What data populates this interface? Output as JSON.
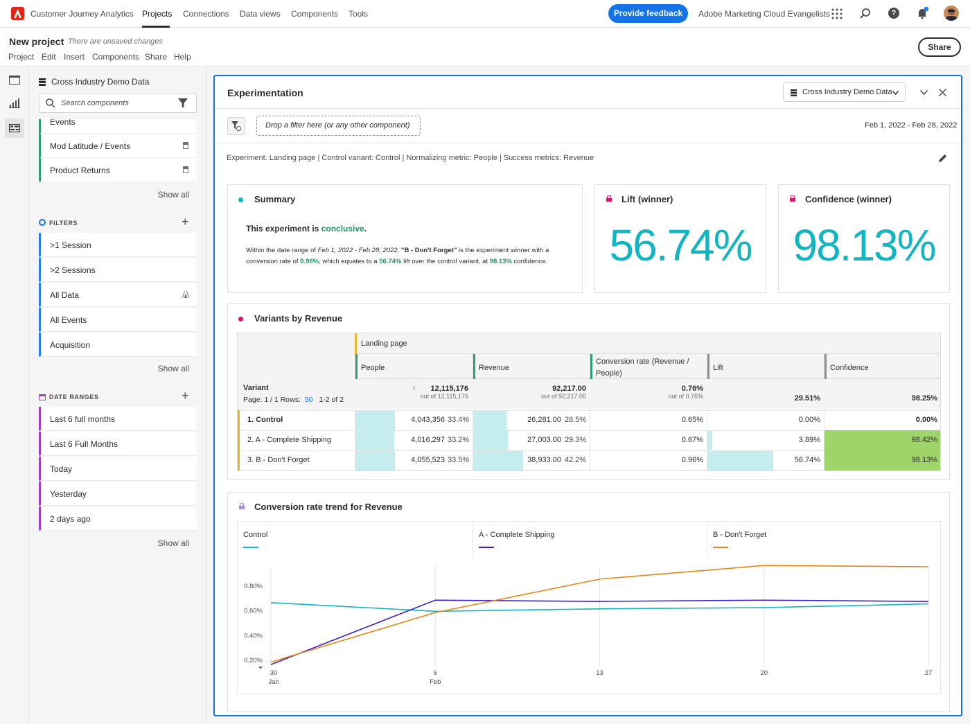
{
  "topbar": {
    "app_title": "Customer Journey Analytics",
    "nav": [
      "Projects",
      "Connections",
      "Data views",
      "Components",
      "Tools"
    ],
    "feedback_button": "Provide feedback",
    "org_name": "Adobe Marketing Cloud Evangelists"
  },
  "project": {
    "title": "New project",
    "unsaved": "There are unsaved changes",
    "menu": [
      "Project",
      "Edit",
      "Insert",
      "Components",
      "Share",
      "Help"
    ],
    "share_button": "Share"
  },
  "left_panel": {
    "dataview": "Cross Industry Demo Data",
    "search_placeholder": "Search components",
    "metrics_partial": "Events",
    "metrics": [
      "Mod Latitude / Events",
      "Product Returns"
    ],
    "show_all": "Show all",
    "filters_header": "FILTERS",
    "filters": [
      ">1 Session",
      ">2 Sessions",
      "All Data",
      "All Events",
      "Acquisition"
    ],
    "dateranges_header": "DATE RANGES",
    "dateranges": [
      "Last 6 full months",
      "Last 6 Full Months",
      "Today",
      "Yesterday",
      "2 days ago"
    ]
  },
  "panel": {
    "title": "Experimentation",
    "dataview": "Cross Industry Demo Data",
    "filter_drop": "Drop a filter here (or any other component)",
    "date_range": "Feb 1, 2022 - Feb 28, 2022",
    "experiment_desc": "Experiment: Landing page | Control variant: Control | Normalizing metric: People | Success metrics: Revenue"
  },
  "summary": {
    "title": "Summary",
    "headline_pre": "This experiment is ",
    "headline_word": "conclusive",
    "headline_post": ".",
    "body_1": "Within the date range of ",
    "body_range": "Feb 1, 2022 - Feb 28, 2022,",
    "body_winner": " \"B - Don't Forget\"",
    "body_2": " is the experiment winner with a conversion rate of ",
    "body_rate": "0.96%",
    "body_3": ", which equates to a ",
    "body_lift": "56.74%",
    "body_4": " lift over the control variant, at ",
    "body_conf": "98.13%",
    "body_5": " confidence."
  },
  "lift_card": {
    "title": "Lift (winner)",
    "value": "56.74%"
  },
  "confidence_card": {
    "title": "Confidence (winner)",
    "value": "98.13%"
  },
  "variants_table": {
    "title": "Variants by Revenue",
    "dimension_header": "Landing page",
    "columns": [
      "People",
      "Revenue",
      "Conversion rate (Revenue / People)",
      "Lift",
      "Confidence"
    ],
    "variant_label": "Variant",
    "page_label": "Page: 1 / 1  Rows:",
    "rows_count": "50",
    "range_label": "1-2 of 2",
    "totals": {
      "people": "12,115,176",
      "people_sub": "out of 12,115,176",
      "revenue": "92,217.00",
      "revenue_sub": "out of 92,217.00",
      "conv": "0.76%",
      "conv_sub": "out of 0.76%",
      "lift": "29.51%",
      "confidence": "98.25%"
    },
    "rows": [
      {
        "name": "1. Control",
        "people": "4,043,356",
        "people_pct": "33.4%",
        "people_frac": 0.334,
        "revenue": "26,281.00",
        "revenue_pct": "28.5%",
        "revenue_frac": 0.285,
        "conv": "0.65%",
        "lift": "0.00%",
        "lift_frac": 0.0,
        "confidence": "0.00%",
        "conf_highlight": false
      },
      {
        "name": "2. A - Complete Shipping",
        "people": "4,016,297",
        "people_pct": "33.2%",
        "people_frac": 0.332,
        "revenue": "27,003.00",
        "revenue_pct": "29.3%",
        "revenue_frac": 0.293,
        "conv": "0.67%",
        "lift": "3.89%",
        "lift_frac": 0.0389,
        "confidence": "98.42%",
        "conf_highlight": true
      },
      {
        "name": "3. B - Don't Forget",
        "people": "4,055,523",
        "people_pct": "33.5%",
        "people_frac": 0.335,
        "revenue": "38,933.00",
        "revenue_pct": "42.2%",
        "revenue_frac": 0.422,
        "conv": "0.96%",
        "lift": "56.74%",
        "lift_frac": 0.5674,
        "confidence": "98.13%",
        "conf_highlight": true
      }
    ]
  },
  "trend": {
    "title": "Conversion rate trend for Revenue"
  },
  "colors": {
    "accent": "#1473e6",
    "teal": "#12b5c0",
    "green_text": "#268e6c",
    "control": "#12b5c0",
    "complete_shipping": "#3f1fd0",
    "dont_forget": "#e68619",
    "conf_green": "#9fd46a",
    "bar": "#c5ecee"
  },
  "chart_data": {
    "type": "line",
    "x": [
      "30 Jan",
      "6 Feb",
      "13",
      "20",
      "27"
    ],
    "x_tick_labels": [
      [
        "30",
        "Jan"
      ],
      [
        "6",
        "Feb"
      ],
      [
        "13",
        ""
      ],
      [
        "20",
        ""
      ],
      [
        "27",
        ""
      ]
    ],
    "y_tick_labels": [
      "0.20%",
      "0.40%",
      "0.60%",
      "0.80%"
    ],
    "y_ticks": [
      0.2,
      0.4,
      0.6,
      0.8
    ],
    "ylim": [
      0.15,
      0.95
    ],
    "series": [
      {
        "name": "Control",
        "color": "#12b5c0",
        "values": [
          0.66,
          0.59,
          0.61,
          0.62,
          0.65
        ]
      },
      {
        "name": "A - Complete Shipping",
        "color": "#3f1fd0",
        "values": [
          0.16,
          0.68,
          0.67,
          0.68,
          0.67
        ]
      },
      {
        "name": "B - Don't Forget",
        "color": "#e68619",
        "values": [
          0.18,
          0.58,
          0.85,
          0.96,
          0.95
        ]
      }
    ]
  }
}
